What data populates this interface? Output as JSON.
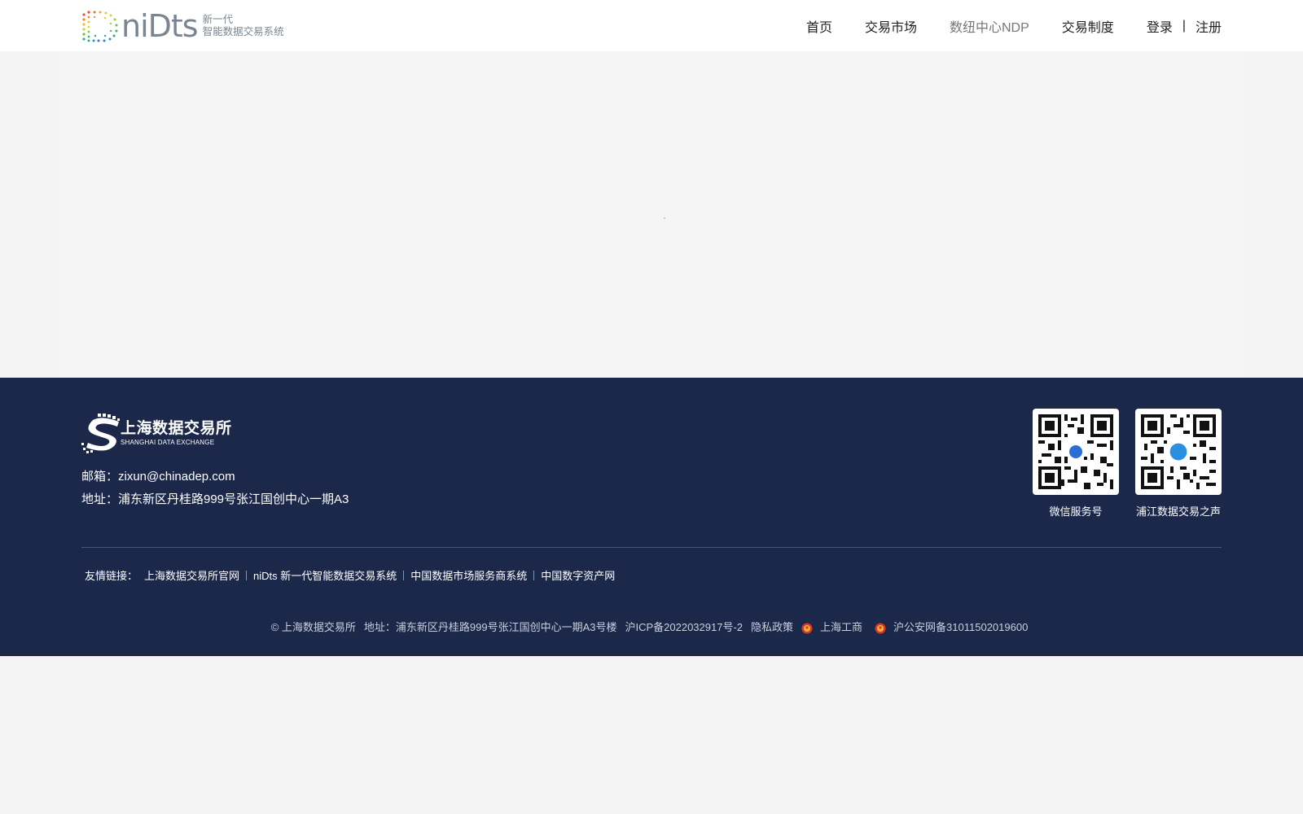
{
  "header": {
    "logo_word": "niDts",
    "logo_sub_line1": "新一代",
    "logo_sub_line2": "智能数据交易系统",
    "nav": {
      "home": "首页",
      "market": "交易市场",
      "ndp": "数纽中心NDP",
      "rules": "交易制度",
      "login": "登录",
      "separator": "|",
      "register": "注册"
    }
  },
  "footer": {
    "logo_cn": "上海数据交易所",
    "logo_en": "SHANGHAI DATA EXCHANGE",
    "email": "邮箱：zixun@chinadep.com",
    "address": "地址：浦东新区丹桂路999号张江国创中心一期A3",
    "qr": {
      "wechat_label": "微信服务号",
      "voice_label": "浦江数据交易之声"
    },
    "links": {
      "title": "友情链接：",
      "items": [
        "上海数据交易所官网",
        "niDts 新一代智能数据交易系统",
        "中国数据市场服务商系统",
        "中国数字资产网"
      ]
    },
    "copyright": {
      "org": "© 上海数据交易所",
      "address": "地址：浦东新区丹桂路999号张江国创中心一期A3号楼",
      "icp": "沪ICP备2022032917号-2",
      "privacy": "隐私政策",
      "biz": "上海工商",
      "police": "沪公安网备31011502019600"
    }
  },
  "colors": {
    "footer_bg": "#1b284a",
    "progress": "#1e8ee8",
    "page_bg": "#f4f4f4"
  }
}
